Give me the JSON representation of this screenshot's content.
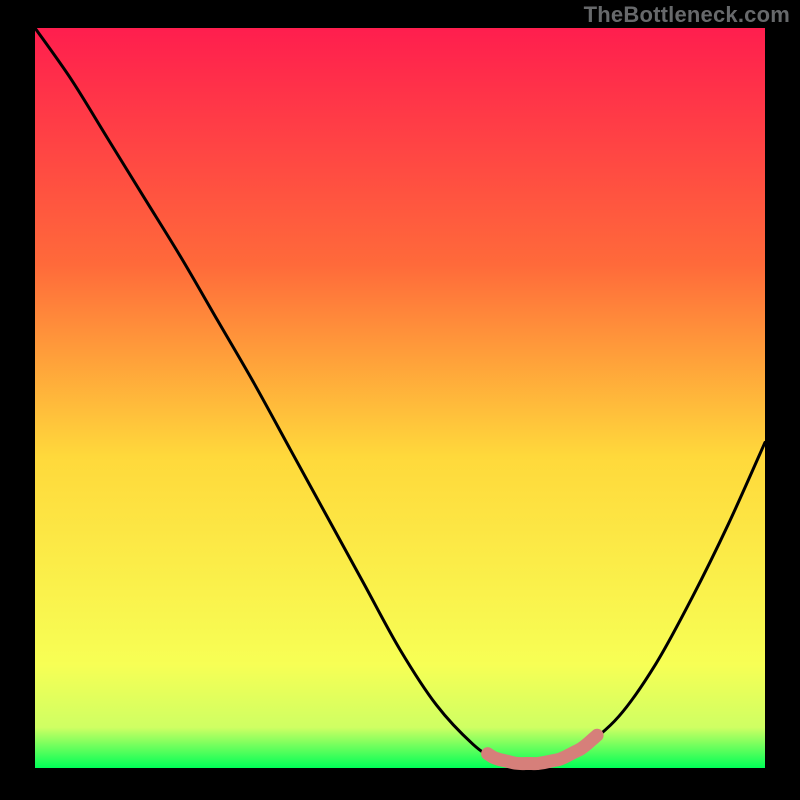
{
  "watermark": "TheBottleneck.com",
  "colors": {
    "black": "#000000",
    "curve": "#000000",
    "highlight": "#d67f7a",
    "gradient_top": "#ff1e4e",
    "gradient_mid": "#ffd93b",
    "gradient_greenish": "#cfff63",
    "gradient_green": "#00ff57"
  },
  "chart_data": {
    "type": "line",
    "title": "",
    "xlabel": "",
    "ylabel": "",
    "xlim": [
      0,
      100
    ],
    "ylim": [
      0,
      100
    ],
    "x": [
      0,
      5,
      10,
      15,
      20,
      25,
      30,
      35,
      40,
      45,
      50,
      55,
      60,
      63,
      66,
      69,
      72,
      75,
      80,
      85,
      90,
      95,
      100
    ],
    "values": [
      100,
      93,
      85,
      77,
      69,
      60.5,
      52,
      43,
      34,
      25,
      16,
      8.5,
      3.2,
      1.3,
      0.6,
      0.6,
      1.2,
      2.7,
      7,
      14,
      23,
      33,
      44
    ],
    "highlight_x_range": [
      62,
      77
    ],
    "highlight_y_approx": 1.2
  }
}
